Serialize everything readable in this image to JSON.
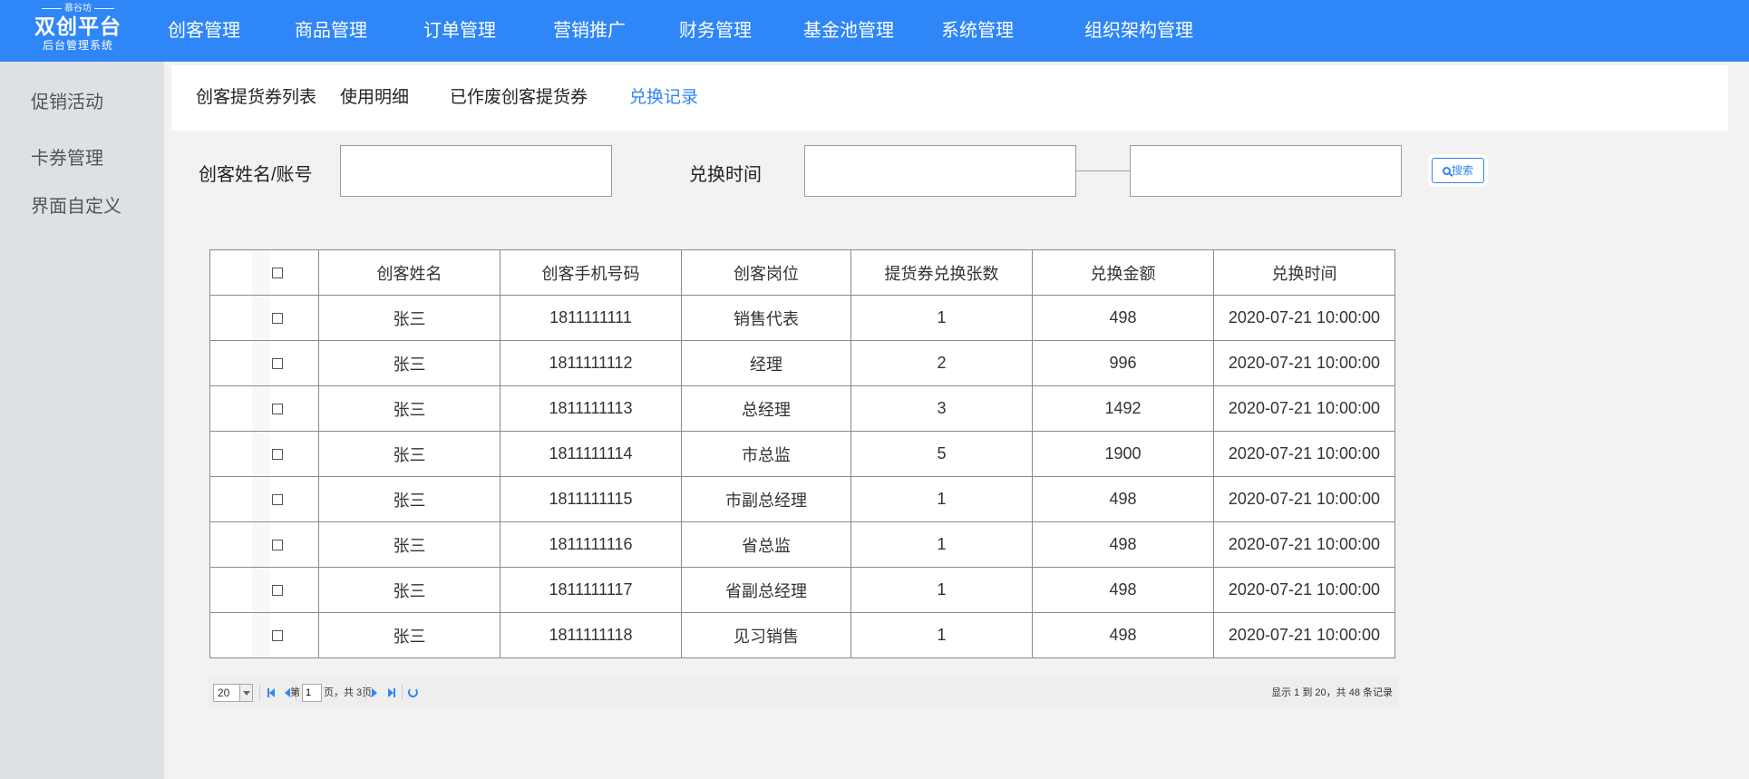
{
  "logo": {
    "tagline": "慕谷坊",
    "title": "双创平台",
    "subtitle": "后台管理系统"
  },
  "nav": [
    "创客管理",
    "商品管理",
    "订单管理",
    "营销推广",
    "财务管理",
    "基金池管理",
    "系统管理",
    "组织架构管理"
  ],
  "sidebar": [
    "促销活动",
    "卡券管理",
    "界面自定义"
  ],
  "tabs": [
    "创客提货券列表",
    "使用明细",
    "已作废创客提货券",
    "兑换记录"
  ],
  "active_tab": "兑换记录",
  "filters": {
    "name_label": "创客姓名/账号",
    "name_value": "",
    "time_label": "兑换时间",
    "time_start": "",
    "time_end": "",
    "search_label": "搜索"
  },
  "table": {
    "headers": [
      "创客姓名",
      "创客手机号码",
      "创客岗位",
      "提货券兑换张数",
      "兑换金额",
      "兑换时间"
    ],
    "rows": [
      [
        "张三",
        "1811111111",
        "销售代表",
        "1",
        "498",
        "2020-07-21 10:00:00"
      ],
      [
        "张三",
        "1811111112",
        "经理",
        "2",
        "996",
        "2020-07-21 10:00:00"
      ],
      [
        "张三",
        "1811111113",
        "总经理",
        "3",
        "1492",
        "2020-07-21 10:00:00"
      ],
      [
        "张三",
        "1811111114",
        "市总监",
        "5",
        "1900",
        "2020-07-21 10:00:00"
      ],
      [
        "张三",
        "1811111115",
        "市副总经理",
        "1",
        "498",
        "2020-07-21 10:00:00"
      ],
      [
        "张三",
        "1811111116",
        "省总监",
        "1",
        "498",
        "2020-07-21 10:00:00"
      ],
      [
        "张三",
        "1811111117",
        "省副总经理",
        "1",
        "498",
        "2020-07-21 10:00:00"
      ],
      [
        "张三",
        "1811111118",
        "见习销售",
        "1",
        "498",
        "2020-07-21 10:00:00"
      ]
    ]
  },
  "pager": {
    "page_size": "20",
    "page_prefix": "第",
    "page_value": "1",
    "page_suffix": "页，共 3页",
    "summary": "显示 1 到 20，共 48 条记录"
  },
  "colors": {
    "brand": "#2f86f6",
    "sidebar": "#dde1e6"
  }
}
